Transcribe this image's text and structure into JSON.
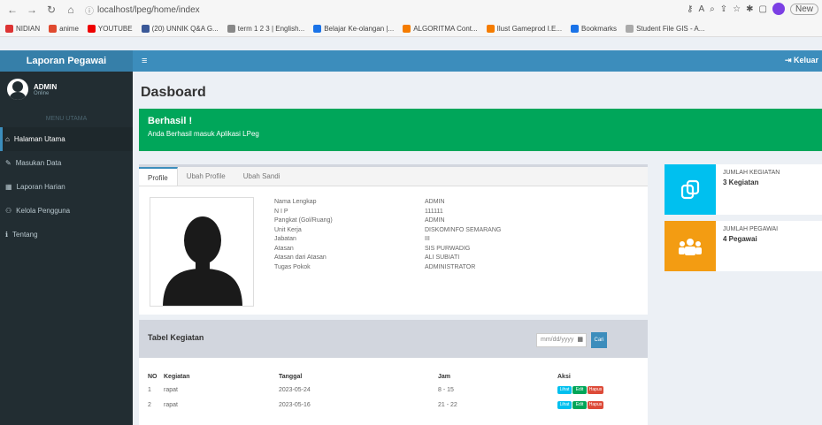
{
  "browser": {
    "url": "localhost/lpeg/home/index",
    "new_tab_label": "New",
    "bookmarks": [
      {
        "label": "NIDIAN",
        "color": "#d33"
      },
      {
        "label": "anime",
        "color": "#e04a2f"
      },
      {
        "label": "YOUTUBE",
        "color": "#e00"
      },
      {
        "label": "(20) UNNIK Q&A G...",
        "color": "#3b5998"
      },
      {
        "label": "term 1 2 3 | English...",
        "color": "#888"
      },
      {
        "label": "Belajar Ke-olangan |...",
        "color": "#1a73e8"
      },
      {
        "label": "ALGORITMA Cont...",
        "color": "#f57c00"
      },
      {
        "label": "Ilust Gameprod I.E...",
        "color": "#f57c00"
      },
      {
        "label": "Bookmarks",
        "color": "#1a73e8"
      },
      {
        "label": "Student File GIS - A...",
        "color": "#aaa"
      }
    ]
  },
  "app": {
    "brand": "Laporan Pegawai",
    "logout_label": "Keluar",
    "user": {
      "name": "ADMIN",
      "status": "Online"
    },
    "nav_header": "MENU UTAMA",
    "menu": [
      {
        "label": "Halaman Utama",
        "icon": "home-icon",
        "active": true
      },
      {
        "label": "Masukan Data",
        "icon": "edit-icon",
        "active": false
      },
      {
        "label": "Laporan Harian",
        "icon": "calendar-icon",
        "active": false
      },
      {
        "label": "Kelola Pengguna",
        "icon": "users-icon",
        "active": false
      },
      {
        "label": "Tentang",
        "icon": "info-icon",
        "active": false
      }
    ]
  },
  "page": {
    "title": "Dasboard",
    "alert": {
      "title": "Berhasil !",
      "message": "Anda Berhasil masuk Aplikasi LPeg"
    },
    "tabs": [
      "Profile",
      "Ubah Profile",
      "Ubah Sandi"
    ],
    "profile": [
      {
        "k": "Nama Lengkap",
        "v": "ADMIN"
      },
      {
        "k": "N I P",
        "v": "111111"
      },
      {
        "k": "Pangkat (Gol/Ruang)",
        "v": "ADMIN"
      },
      {
        "k": "Unit Kerja",
        "v": "DISKOMINFO SEMARANG"
      },
      {
        "k": "Jabatan",
        "v": "III"
      },
      {
        "k": "Atasan",
        "v": "SIS PURWADIG"
      },
      {
        "k": "Atasan dari Atasan",
        "v": "ALI SUBIATI"
      },
      {
        "k": "Tugas Pokok",
        "v": "ADMINISTRATOR"
      }
    ],
    "stats": [
      {
        "label": "JUMLAH KEGIATAN",
        "value": "3 Kegiatan",
        "color": "#00c0ef",
        "icon": "copy-icon"
      },
      {
        "label": "JUMLAH PEGAWAI",
        "value": "4 Pegawai",
        "color": "#f39c12",
        "icon": "users-icon"
      }
    ],
    "table": {
      "title": "Tabel Kegiatan",
      "date_placeholder": "mm/dd/yyyy",
      "search_label": "Cari",
      "columns": [
        "NO",
        "Kegiatan",
        "Tanggal",
        "Jam",
        "Aksi"
      ],
      "rows": [
        {
          "no": "1",
          "kegiatan": "rapat",
          "tanggal": "2023-05-24",
          "jam": "8 - 15"
        },
        {
          "no": "2",
          "kegiatan": "rapat",
          "tanggal": "2023-05-16",
          "jam": "21 - 22"
        }
      ],
      "actions": [
        "Lihat",
        "Edit",
        "Hapus"
      ]
    }
  }
}
